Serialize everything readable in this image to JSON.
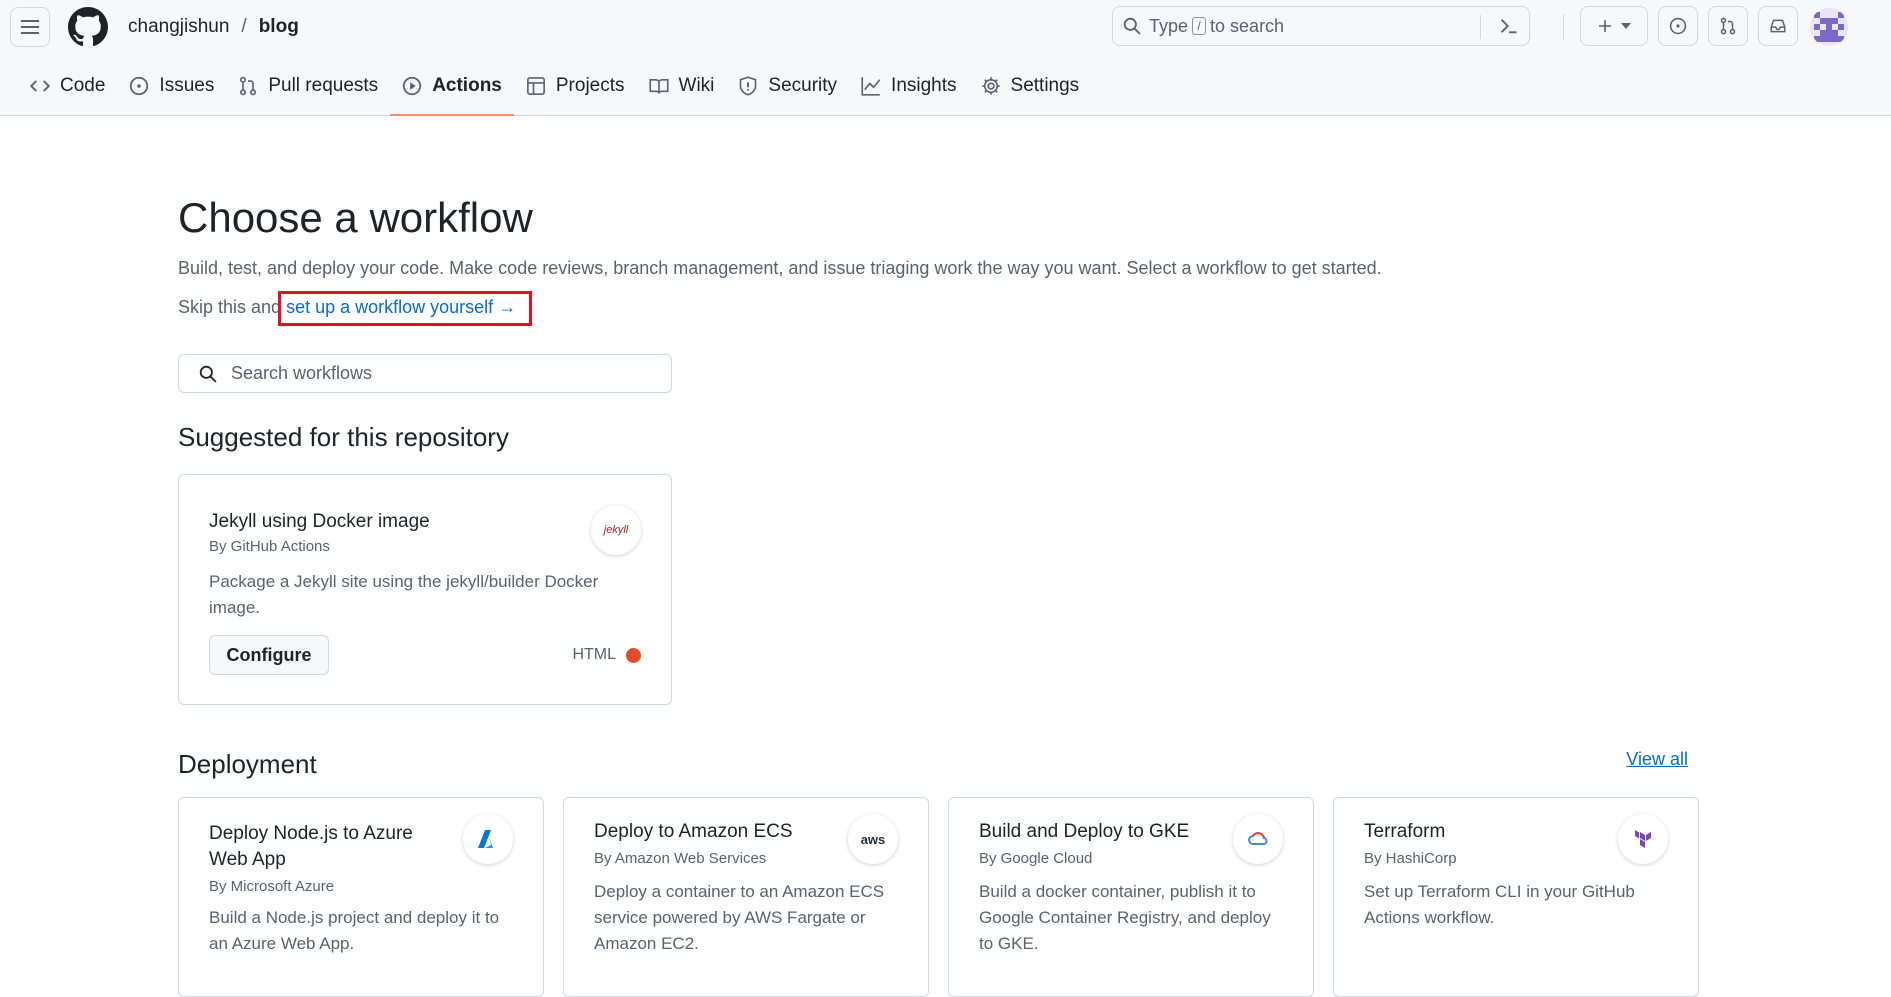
{
  "header": {
    "owner": "changjishun",
    "separator": "/",
    "repo": "blog",
    "search": {
      "prefix": "Type",
      "slash": "/",
      "suffix": "to search"
    }
  },
  "tabs": [
    {
      "label": "Code",
      "icon": "code-icon"
    },
    {
      "label": "Issues",
      "icon": "issue-opened-icon"
    },
    {
      "label": "Pull requests",
      "icon": "git-pull-request-icon"
    },
    {
      "label": "Actions",
      "icon": "play-icon",
      "active": true
    },
    {
      "label": "Projects",
      "icon": "table-icon"
    },
    {
      "label": "Wiki",
      "icon": "book-icon"
    },
    {
      "label": "Security",
      "icon": "shield-icon"
    },
    {
      "label": "Insights",
      "icon": "graph-icon"
    },
    {
      "label": "Settings",
      "icon": "gear-icon"
    }
  ],
  "main": {
    "title": "Choose a workflow",
    "description": "Build, test, and deploy your code. Make code reviews, branch management, and issue triaging work the way you want. Select a workflow to get started.",
    "skip_prefix": "Skip this and",
    "skip_link": "set up a workflow yourself",
    "skip_arrow": "→",
    "search_placeholder": "Search workflows"
  },
  "suggested": {
    "heading": "Suggested for this repository",
    "card": {
      "title": "Jekyll using Docker image",
      "by": "By GitHub Actions",
      "description": "Package a Jekyll site using the jekyll/builder Docker image.",
      "button": "Configure",
      "language": "HTML",
      "language_color": "#e34c26",
      "logo_text": "jekyll"
    }
  },
  "deployment": {
    "heading": "Deployment",
    "view_all": "View all",
    "cards": [
      {
        "title": "Deploy Node.js to Azure Web App",
        "by": "By Microsoft Azure",
        "description": "Build a Node.js project and deploy it to an Azure Web App.",
        "logo": "azure-icon"
      },
      {
        "title": "Deploy to Amazon ECS",
        "by": "By Amazon Web Services",
        "description": "Deploy a container to an Amazon ECS service powered by AWS Fargate or Amazon EC2.",
        "logo": "aws-icon",
        "logo_text": "aws"
      },
      {
        "title": "Build and Deploy to GKE",
        "by": "By Google Cloud",
        "description": "Build a docker container, publish it to Google Container Registry, and deploy to GKE.",
        "logo": "google-cloud-icon"
      },
      {
        "title": "Terraform",
        "by": "By HashiCorp",
        "description": "Set up Terraform CLI in your GitHub Actions workflow.",
        "logo": "terraform-icon"
      }
    ]
  }
}
